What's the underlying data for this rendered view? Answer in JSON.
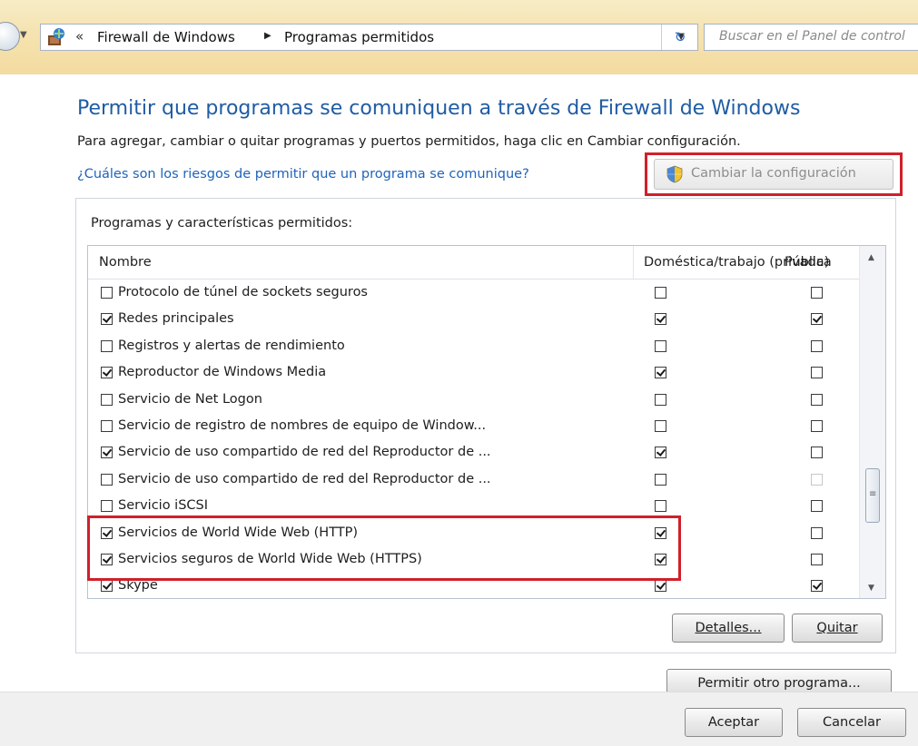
{
  "address_bar": {
    "breadcrumb_chevron": "«",
    "crumb1": "Firewall de Windows",
    "crumb2": "Programas permitidos",
    "search_placeholder": "Buscar en el Panel de control"
  },
  "page": {
    "title": "Permitir que programas se comuniquen a través de Firewall de Windows",
    "description": "Para agregar, cambiar o quitar programas y puertos permitidos, haga clic en Cambiar configuración.",
    "risk_link": "¿Cuáles son los riesgos de permitir que un programa se comunique?",
    "change_settings_label": "Cambiar la configuración"
  },
  "group": {
    "label": "Programas y características permitidos:",
    "columns": {
      "name": "Nombre",
      "domestic": "Doméstica/trabajo (privada)",
      "public": "Pública"
    },
    "rows": [
      {
        "name": "Protocolo de túnel de sockets seguros",
        "enabled": false,
        "domestic": false,
        "public": false
      },
      {
        "name": "Redes principales",
        "enabled": true,
        "domestic": true,
        "public": true
      },
      {
        "name": "Registros y alertas de rendimiento",
        "enabled": false,
        "domestic": false,
        "public": false
      },
      {
        "name": "Reproductor de Windows Media",
        "enabled": true,
        "domestic": true,
        "public": false
      },
      {
        "name": "Servicio de Net Logon",
        "enabled": false,
        "domestic": false,
        "public": false
      },
      {
        "name": "Servicio de registro de nombres de equipo de Window...",
        "enabled": false,
        "domestic": false,
        "public": false
      },
      {
        "name": "Servicio de uso compartido de red del Reproductor de ...",
        "enabled": true,
        "domestic": true,
        "public": false
      },
      {
        "name": "Servicio de uso compartido de red del Reproductor de ...",
        "enabled": false,
        "domestic": false,
        "public": false,
        "public_disabled": true
      },
      {
        "name": "Servicio iSCSI",
        "enabled": false,
        "domestic": false,
        "public": false
      },
      {
        "name": "Servicios de World Wide Web (HTTP)",
        "enabled": true,
        "domestic": true,
        "public": false
      },
      {
        "name": "Servicios seguros de World Wide Web (HTTPS)",
        "enabled": true,
        "domestic": true,
        "public": false
      },
      {
        "name": "Skype",
        "enabled": true,
        "domestic": true,
        "public": true
      }
    ]
  },
  "buttons": {
    "details": "Detalles...",
    "remove": "Quitar",
    "allow_other": "Permitir otro programa...",
    "ok": "Aceptar",
    "cancel": "Cancelar"
  },
  "colors": {
    "title_blue": "#1f5ca4",
    "link_blue": "#1f63b8",
    "highlight_red": "#d0202a"
  }
}
